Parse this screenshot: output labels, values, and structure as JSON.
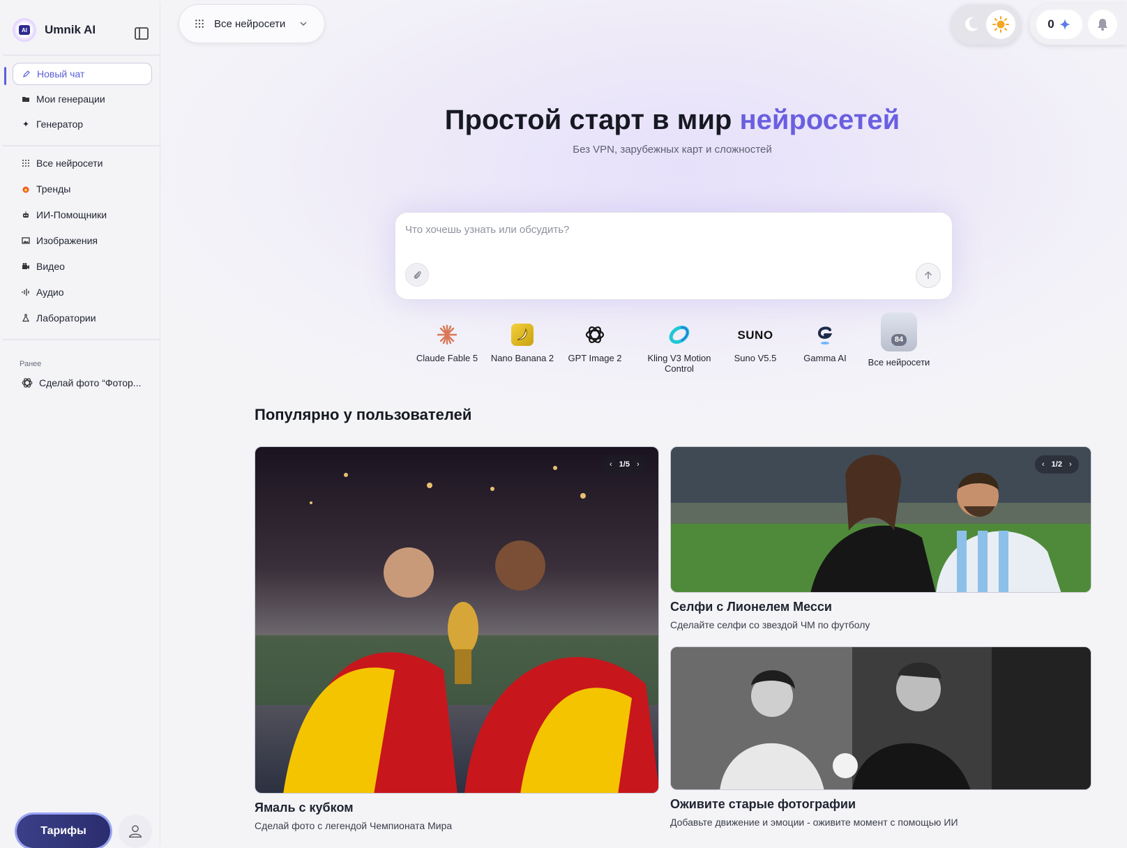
{
  "sidebar": {
    "brand": "Umnik AI",
    "logo_text": "AI",
    "nav_primary": [
      {
        "label": "Новый чат",
        "icon": "pen-icon"
      },
      {
        "label": "Мои генерации",
        "icon": "folder-icon"
      },
      {
        "label": "Генератор",
        "icon": "sparkle-icon"
      }
    ],
    "nav_categories": [
      {
        "label": "Все нейросети",
        "icon": "grid-icon"
      },
      {
        "label": "Тренды",
        "icon": "fire-icon"
      },
      {
        "label": "ИИ-Помощники",
        "icon": "robot-icon"
      },
      {
        "label": "Изображения",
        "icon": "image-icon"
      },
      {
        "label": "Видео",
        "icon": "video-camera-icon"
      },
      {
        "label": "Аудио",
        "icon": "audio-wave-icon"
      },
      {
        "label": "Лаборатории",
        "icon": "flask-icon"
      }
    ],
    "history_label": "Ранее",
    "history_items": [
      {
        "label": "Сделай фото “Фотор...",
        "icon": "openai-icon"
      }
    ],
    "tariffs_label": "Тарифы"
  },
  "topbar": {
    "model_select_label": "Все нейросети",
    "credits": "0"
  },
  "hero": {
    "title_main": "Простой старт в мир",
    "title_accent": "нейросетей",
    "subtitle": "Без VPN, зарубежных карт и сложностей",
    "input_placeholder": "Что хочешь узнать или обсудить?"
  },
  "models": [
    {
      "label": "Claude Fable 5",
      "icon": "claude-icon"
    },
    {
      "label": "Nano Banana 2",
      "icon": "banana-icon"
    },
    {
      "label": "GPT Image 2",
      "icon": "openai-icon"
    },
    {
      "label": "Kling V3 Motion Control",
      "icon": "kling-icon"
    },
    {
      "label": "Suno V5.5",
      "icon": "suno-logo",
      "logo_text": "SUNO"
    },
    {
      "label": "Gamma AI",
      "icon": "gamma-icon"
    },
    {
      "label": "Все нейросети",
      "icon": "all-models-icon",
      "count": "84"
    }
  ],
  "popular": {
    "title": "Популярно у пользователей",
    "cards": [
      {
        "title": "Ямаль с кубком",
        "desc": "Сделай фото с легендой Чемпионата Мира",
        "pager": "1/5"
      },
      {
        "title": "Селфи с Лионелем Месси",
        "desc": "Сделайте селфи со звездой ЧМ по футболу",
        "pager": "1/2"
      },
      {
        "title": "Оживите старые фотографии",
        "desc": "Добавьте движение и эмоции - оживите момент с помощью ИИ"
      }
    ]
  },
  "colors": {
    "accent": "#6a5fe0",
    "tariffs_button": "#2a2d6e"
  }
}
